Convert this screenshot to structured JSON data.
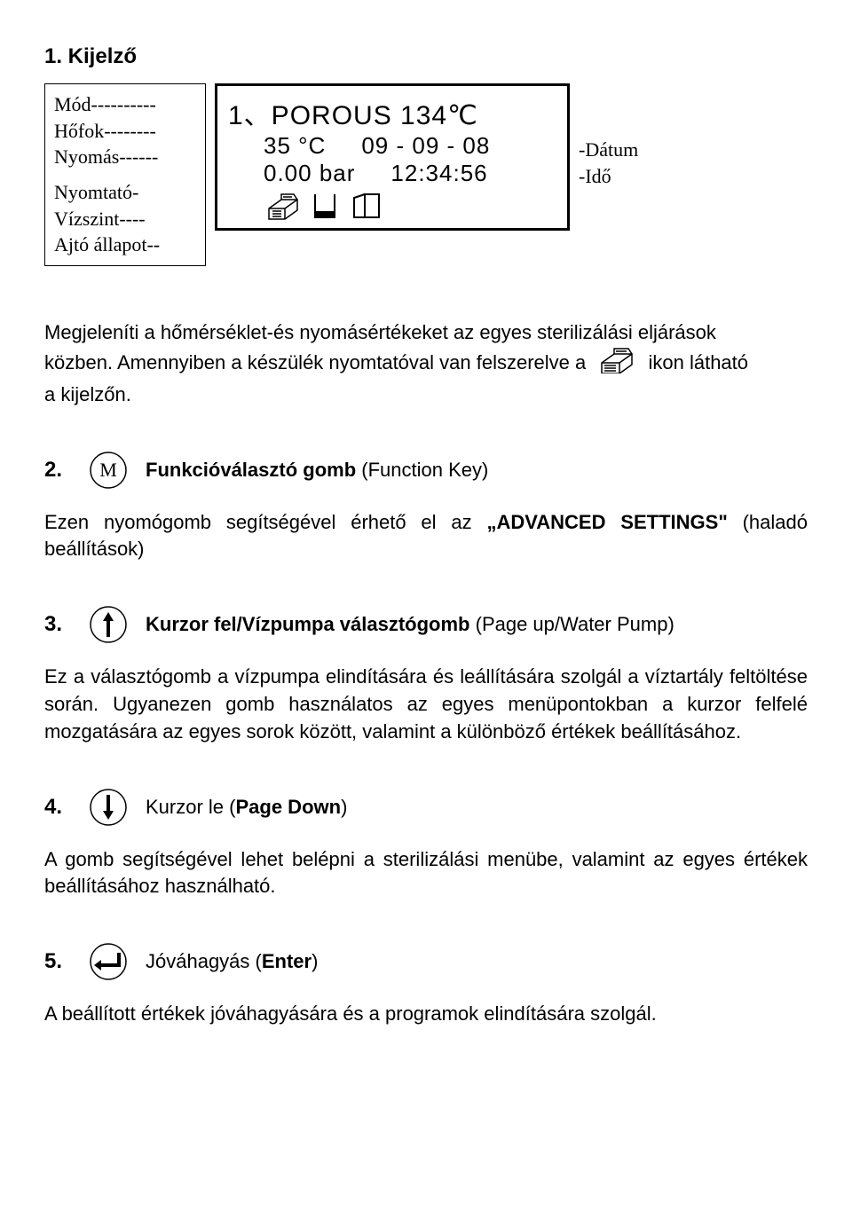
{
  "heading1": "1. Kijelző",
  "leftLabels": {
    "l1": "Mód----------",
    "l2": "Hőfok--------",
    "l3": "Nyomás------",
    "l4": "Nyomtató-",
    "l5": "Vízszint----",
    "l6": "Ajtó állapot--"
  },
  "display": {
    "line1": "1、POROUS 134℃",
    "line2a": "35 °C",
    "line2b": "09 - 09 - 08",
    "line3a": "0.00 bar",
    "line3b": "12:34:56"
  },
  "rightLabels": {
    "r1": "-Dátum",
    "r2": "-Idő"
  },
  "para1a": "Megjeleníti a hőmérséklet-és nyomásértékeket az egyes sterilizálási eljárások",
  "para1b_pre": "közben. Amennyiben a készülék nyomtatóval van felszerelve a",
  "para1b_post": "ikon látható",
  "para1c": "a kijelzőn.",
  "sec2": {
    "num": "2.",
    "title_b": "Funkcióválasztó gomb",
    "title_rest": " (Function Key)"
  },
  "para2a": "Ezen nyomógomb segítségével érhető el az ",
  "para2b": "„ADVANCED SETTINGS\"",
  "para2c": " (haladó beállítások)",
  "sec3": {
    "num": "3.",
    "title_b": "Kurzor fel/Vízpumpa választógomb",
    "title_rest": " (Page up/Water Pump)"
  },
  "para3": "Ez a választógomb a vízpumpa elindítására és leállítására szolgál a víztartály feltöltése során. Ugyanezen gomb használatos az egyes menüpontokban a kurzor felfelé mozgatására az egyes sorok között, valamint a különböző értékek beállításához.",
  "sec4": {
    "num": "4.",
    "title_pre": "Kurzor le (",
    "title_b": "Page Down",
    "title_post": ")"
  },
  "para4": "A gomb segítségével lehet belépni a sterilizálási menübe, valamint az egyes értékek beállításához használható.",
  "sec5": {
    "num": "5.",
    "title_pre": "Jóváhagyás (",
    "title_b": "Enter",
    "title_post": ")"
  },
  "para5": "A beállított értékek jóváhagyására és a programok elindítására szolgál."
}
